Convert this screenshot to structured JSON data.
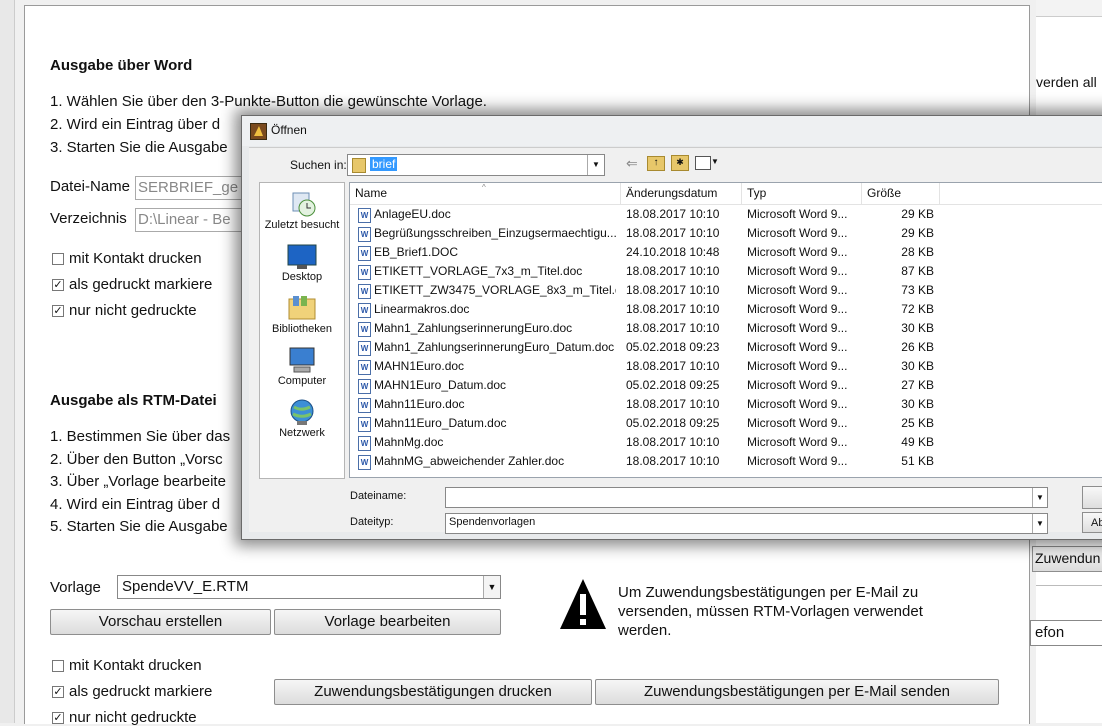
{
  "background": {
    "right_strip": {
      "t1": "verden all",
      "t2": "Zuwendun",
      "t3": "efon"
    },
    "section_word": {
      "title": "Ausgabe über Word",
      "steps": [
        "1. Wählen Sie über den 3-Punkte-Button die gewünschte Vorlage.",
        "2. Wird ein Eintrag über d",
        "3. Starten Sie die Ausgabe"
      ],
      "datei_label": "Datei-Name",
      "datei_value": "SERBRIEF_ge",
      "verz_label": "Verzeichnis",
      "verz_value": "D:\\Linear - Be",
      "cb_kontakt": "mit Kontakt drucken",
      "cb_gedruckt": "als gedruckt markiere",
      "cb_nicht": "nur nicht gedruckte"
    },
    "section_rtm": {
      "title": "Ausgabe als RTM-Datei",
      "steps": [
        "1. Bestimmen Sie über das",
        "2. Über den Button „Vorsc",
        "3. Über „Vorlage bearbeite",
        "4. Wird ein Eintrag über d",
        "5. Starten Sie die Ausgabe"
      ],
      "vorlage_label": "Vorlage",
      "vorlage_value": "SpendeVV_E.RTM",
      "btn_vorschau": "Vorschau erstellen",
      "btn_bearbeiten": "Vorlage bearbeiten",
      "warning_text": "Um Zuwendungsbestätigungen per E-Mail zu versenden, müssen RTM-Vorlagen verwendet werden.",
      "cb_kontakt": "mit Kontakt drucken",
      "cb_gedruckt": "als gedruckt markiere",
      "cb_nicht": "nur nicht gedruckte",
      "btn_drucken": "Zuwendungsbestätigungen drucken",
      "btn_email": "Zuwendungsbestätigungen per E-Mail senden"
    }
  },
  "dialog": {
    "title": "Öffnen",
    "suchen_label": "Suchen in:",
    "suchen_value": "brief",
    "places": [
      "Zuletzt besucht",
      "Desktop",
      "Bibliotheken",
      "Computer",
      "Netzwerk"
    ],
    "columns": [
      "Name",
      "Änderungsdatum",
      "Typ",
      "Größe"
    ],
    "files": [
      {
        "name": "AnlageEU.doc",
        "date": "18.08.2017 10:10",
        "type": "Microsoft Word 9...",
        "size": "29 KB"
      },
      {
        "name": "Begrüßungsschreiben_Einzugsermaechtigu...",
        "date": "18.08.2017 10:10",
        "type": "Microsoft Word 9...",
        "size": "29 KB"
      },
      {
        "name": "EB_Brief1.DOC",
        "date": "24.10.2018 10:48",
        "type": "Microsoft Word 9...",
        "size": "28 KB"
      },
      {
        "name": "ETIKETT_VORLAGE_7x3_m_Titel.doc",
        "date": "18.08.2017 10:10",
        "type": "Microsoft Word 9...",
        "size": "87 KB"
      },
      {
        "name": "ETIKETT_ZW3475_VORLAGE_8x3_m_Titel.doc",
        "date": "18.08.2017 10:10",
        "type": "Microsoft Word 9...",
        "size": "73 KB"
      },
      {
        "name": "Linearmakros.doc",
        "date": "18.08.2017 10:10",
        "type": "Microsoft Word 9...",
        "size": "72 KB"
      },
      {
        "name": "Mahn1_ZahlungserinnerungEuro.doc",
        "date": "18.08.2017 10:10",
        "type": "Microsoft Word 9...",
        "size": "30 KB"
      },
      {
        "name": "Mahn1_ZahlungserinnerungEuro_Datum.doc",
        "date": "05.02.2018 09:23",
        "type": "Microsoft Word 9...",
        "size": "26 KB"
      },
      {
        "name": "MAHN1Euro.doc",
        "date": "18.08.2017 10:10",
        "type": "Microsoft Word 9...",
        "size": "30 KB"
      },
      {
        "name": "MAHN1Euro_Datum.doc",
        "date": "05.02.2018 09:25",
        "type": "Microsoft Word 9...",
        "size": "27 KB"
      },
      {
        "name": "Mahn11Euro.doc",
        "date": "18.08.2017 10:10",
        "type": "Microsoft Word 9...",
        "size": "30 KB"
      },
      {
        "name": "Mahn11Euro_Datum.doc",
        "date": "05.02.2018 09:25",
        "type": "Microsoft Word 9...",
        "size": "25 KB"
      },
      {
        "name": "MahnMg.doc",
        "date": "18.08.2017 10:10",
        "type": "Microsoft Word 9...",
        "size": "49 KB"
      },
      {
        "name": "MahnMG_abweichender Zahler.doc",
        "date": "18.08.2017 10:10",
        "type": "Microsoft Word 9...",
        "size": "51 KB"
      }
    ],
    "dateiname_label": "Dateiname:",
    "dateiname_value": "",
    "dateityp_label": "Dateityp:",
    "dateityp_value": "Spendenvorlagen",
    "btn_cut": "Ab"
  }
}
